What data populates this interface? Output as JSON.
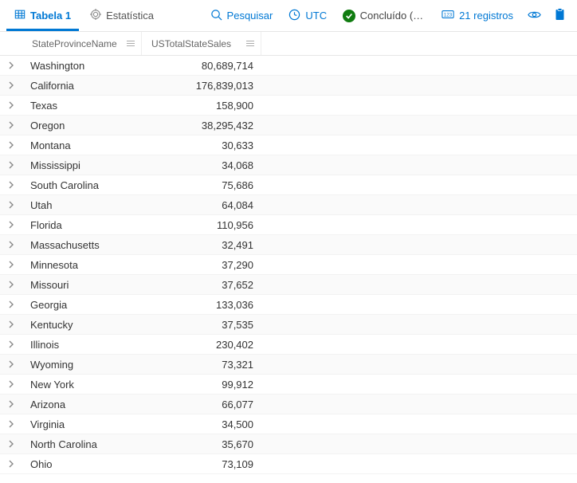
{
  "toolbar": {
    "tab_table": "Tabela 1",
    "tab_stats": "Estatística",
    "search": "Pesquisar",
    "utc": "UTC",
    "status": "Concluído (0...",
    "records": "21 registros"
  },
  "columns": {
    "state": "StateProvinceName",
    "sales": "USTotalStateSales"
  },
  "rows": [
    {
      "state": "Washington",
      "sales": "80,689,714"
    },
    {
      "state": "California",
      "sales": "176,839,013"
    },
    {
      "state": "Texas",
      "sales": "158,900"
    },
    {
      "state": "Oregon",
      "sales": "38,295,432"
    },
    {
      "state": "Montana",
      "sales": "30,633"
    },
    {
      "state": "Mississippi",
      "sales": "34,068"
    },
    {
      "state": "South Carolina",
      "sales": "75,686"
    },
    {
      "state": "Utah",
      "sales": "64,084"
    },
    {
      "state": "Florida",
      "sales": "110,956"
    },
    {
      "state": "Massachusetts",
      "sales": "32,491"
    },
    {
      "state": "Minnesota",
      "sales": "37,290"
    },
    {
      "state": "Missouri",
      "sales": "37,652"
    },
    {
      "state": "Georgia",
      "sales": "133,036"
    },
    {
      "state": "Kentucky",
      "sales": "37,535"
    },
    {
      "state": "Illinois",
      "sales": "230,402"
    },
    {
      "state": "Wyoming",
      "sales": "73,321"
    },
    {
      "state": "New York",
      "sales": "99,912"
    },
    {
      "state": "Arizona",
      "sales": "66,077"
    },
    {
      "state": "Virginia",
      "sales": "34,500"
    },
    {
      "state": "North Carolina",
      "sales": "35,670"
    },
    {
      "state": "Ohio",
      "sales": "73,109"
    }
  ]
}
